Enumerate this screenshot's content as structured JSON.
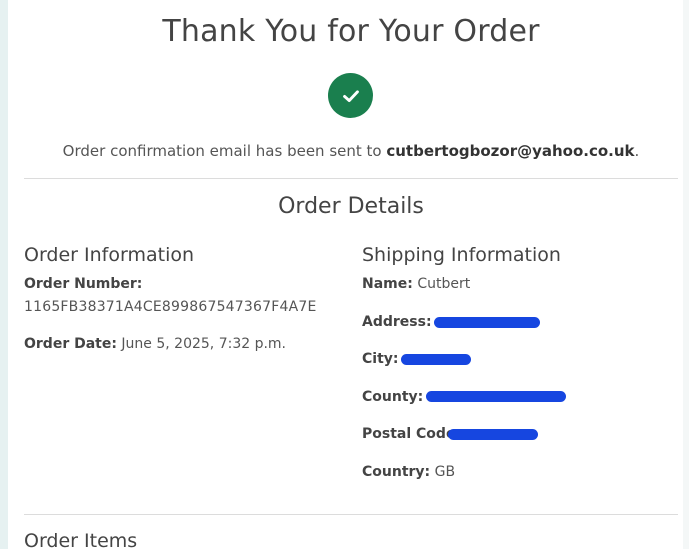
{
  "header": {
    "title": "Thank You for Your Order",
    "confirmation_prefix": "Order confirmation email has been sent to ",
    "email": "cutbertogbozor@yahoo.co.uk",
    "confirmation_suffix": "."
  },
  "order_details": {
    "section_title": "Order Details",
    "order_info": {
      "heading": "Order Information",
      "order_number_label": "Order Number:",
      "order_number": "1165FB38371A4CE899867547367F4A7E",
      "order_date_label": "Order Date:",
      "order_date": "June 5, 2025, 7:32 p.m."
    },
    "shipping_info": {
      "heading": "Shipping Information",
      "name_label": "Name:",
      "name": "Cutbert",
      "address_label": "Address:",
      "city_label": "City:",
      "county_label": "County:",
      "postal_code_label": "Postal Code:",
      "country_label": "Country:",
      "country": "GB"
    }
  },
  "order_items": {
    "heading": "Order Items"
  },
  "colors": {
    "success": "#1a7f4e",
    "redaction": "#1646e0",
    "divider": "#dcdcdc"
  },
  "icons": {
    "status": "checkmark-icon"
  }
}
